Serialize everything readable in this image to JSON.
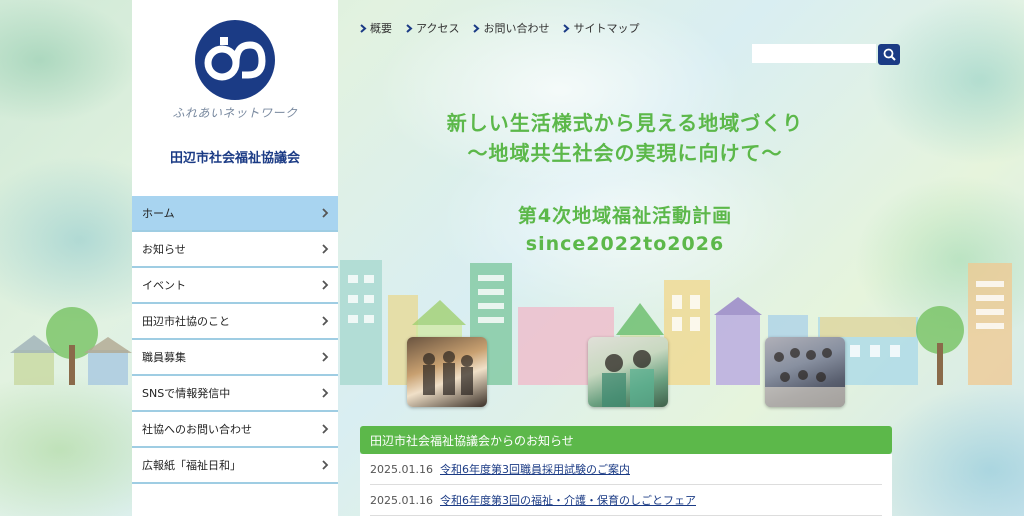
{
  "logo": {
    "subtitle": "ふれあいネットワーク"
  },
  "org_name": "田辺市社会福祉協議会",
  "menu": [
    {
      "label": "ホーム"
    },
    {
      "label": "お知らせ"
    },
    {
      "label": "イベント"
    },
    {
      "label": "田辺市社協のこと"
    },
    {
      "label": "職員募集"
    },
    {
      "label": "SNSで情報発信中"
    },
    {
      "label": "社協へのお問い合わせ"
    },
    {
      "label": "広報紙「福祉日和」"
    }
  ],
  "topnav": [
    {
      "label": "概要"
    },
    {
      "label": "アクセス"
    },
    {
      "label": "お問い合わせ"
    },
    {
      "label": "サイトマップ"
    }
  ],
  "search": {
    "placeholder": ""
  },
  "hero": {
    "line1": "新しい生活様式から見える地域づくり",
    "line2": "〜地域共生社会の実現に向けて〜",
    "line3": "第4次地域福祉活動計画",
    "line4": "since2022to2026"
  },
  "news": {
    "heading": "田辺市社会福祉協議会からのお知らせ",
    "items": [
      {
        "date": "2025.01.16",
        "title": "令和6年度第3回職員採用試験のご案内"
      },
      {
        "date": "2025.01.16",
        "title": "令和6年度第3回の福祉・介護・保育のしごとフェア"
      }
    ]
  },
  "colors": {
    "brand": "#1b3b85",
    "accent": "#5cb84a",
    "menu_active": "#a8d4f0"
  }
}
